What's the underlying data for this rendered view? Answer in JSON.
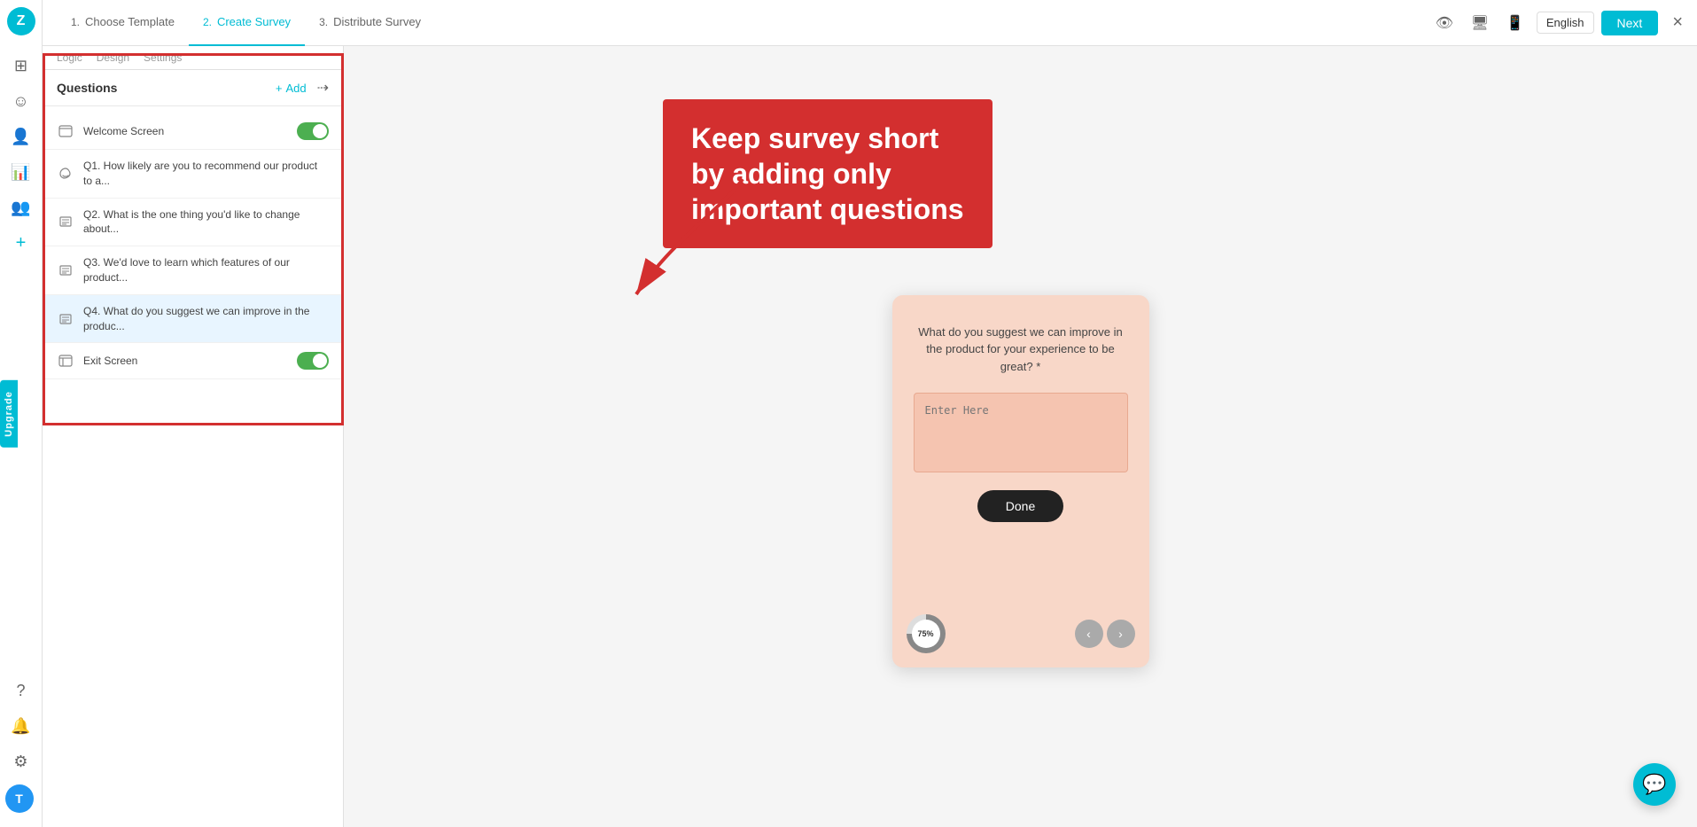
{
  "app": {
    "logo": "Z",
    "upgrade_label": "Upgrade"
  },
  "header": {
    "steps": [
      {
        "num": "1.",
        "label": "Choose Template",
        "active": false
      },
      {
        "num": "2.",
        "label": "Create Survey",
        "active": true
      },
      {
        "num": "3.",
        "label": "Distribute Survey",
        "active": false
      }
    ],
    "close_icon": "×",
    "language": "English",
    "next_label": "Next"
  },
  "sidebar_icons": [
    {
      "name": "grid-icon",
      "symbol": "⊞"
    },
    {
      "name": "user-circle-icon",
      "symbol": "○"
    },
    {
      "name": "calendar-icon",
      "symbol": "⊡"
    },
    {
      "name": "users-icon",
      "symbol": "⊕"
    }
  ],
  "panel": {
    "tabs": [
      {
        "label": "Questions",
        "active": true
      },
      {
        "label": "+ Add",
        "active": false
      }
    ],
    "reorder_icon": "≡→",
    "questions": [
      {
        "id": "welcome",
        "icon": "🏠",
        "icon_name": "welcome-icon",
        "text": "Welcome Screen",
        "has_toggle": true,
        "toggle_on": true
      },
      {
        "id": "q1",
        "icon": "♡",
        "icon_name": "nps-icon",
        "text": "Q1. How likely are you to recommend our product to a...",
        "has_toggle": false
      },
      {
        "id": "q2",
        "icon": "☰",
        "icon_name": "text-icon",
        "text": "Q2. What is the one thing you'd like to change about...",
        "has_toggle": false
      },
      {
        "id": "q3",
        "icon": "☰",
        "icon_name": "text-icon-2",
        "text": "Q3. We'd love to learn which features of our product...",
        "has_toggle": false
      },
      {
        "id": "q4",
        "icon": "☰",
        "icon_name": "text-icon-3",
        "text": "Q4. What do you suggest we can improve in the produc...",
        "has_toggle": false,
        "active": true
      },
      {
        "id": "exit",
        "icon": "⬚",
        "icon_name": "exit-icon",
        "text": "Exit Screen",
        "has_toggle": true,
        "toggle_on": true
      }
    ]
  },
  "tooltip": {
    "text": "Keep survey short\nby adding only\nimportant questions"
  },
  "preview": {
    "question_text": "What do you suggest we can improve in the product for your experience to be great? *",
    "textarea_placeholder": "Enter Here",
    "done_button": "Done",
    "progress_percent": "75%"
  },
  "chat": {
    "icon": "💬"
  }
}
